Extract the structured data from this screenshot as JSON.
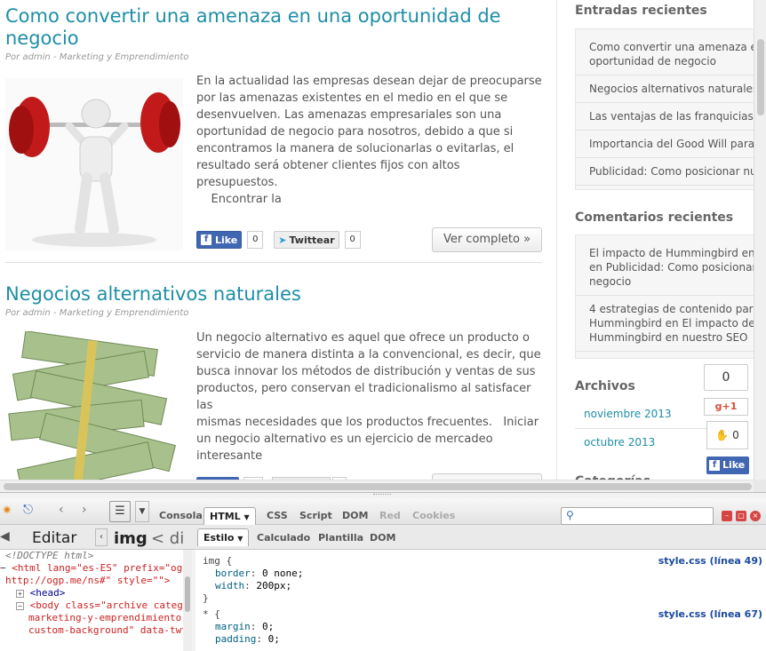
{
  "posts": [
    {
      "title_line1": "Como convertir una amenaza en una oportunidad de",
      "title_line2": "negocio",
      "meta": "Por admin - Marketing y Emprendimiento",
      "excerpt": [
        "En la actualidad las empresas desean dejar de preocuparse",
        "por las amenazas existentes en el medio en el que se",
        "desenvuelven. Las amenazas empresariales son una",
        "oportunidad de negocio para nosotros, debido a que si",
        "encontramos la manera de solucionarlas o evitarlas, el",
        "resultado será obtener clientes fijos con altos presupuestos.",
        "    Encontrar la"
      ],
      "like_label": "Like",
      "like_count": "0",
      "tweet_label": "Twittear",
      "tweet_count": "0",
      "more_label": "Ver completo »"
    },
    {
      "title_line1": "Negocios alternativos naturales",
      "meta": "Por admin - Marketing y Emprendimiento",
      "excerpt": [
        "Un negocio alternativo es aquel que ofrece un producto o",
        "servicio de manera distinta a la convencional, es decir, que",
        "busca innovar los métodos de distribución y ventas de sus",
        "productos, pero conservan el tradicionalismo al satisfacer las",
        "mismas necesidades que los productos frecuentes.   Iniciar",
        "un negocio alternativo es un ejercicio de mercadeo",
        "interesante"
      ]
    }
  ],
  "sidebar": {
    "recent_title": "Entradas recientes",
    "recent": [
      "Como convertir una amenaza e",
      "oportunidad de negocio",
      "Negocios alternativos naturales",
      "Las ventajas de las franquicias c",
      "Importancia del Good Will para",
      "Publicidad: Como posicionar nu"
    ],
    "comments_title": "Comentarios recientes",
    "comments": [
      "El impacto de Hummingbird en",
      "en Publicidad: Como posicionar",
      "negocio",
      "4 estrategias de contenido para",
      "Hummingbird en El impacto de",
      "Hummingbird en nuestro SEO"
    ],
    "archives_title": "Archivos",
    "archives": [
      "noviembre 2013",
      "octubre 2013"
    ],
    "cat_title": "Categorías"
  },
  "float_share": {
    "count": "0",
    "gplus": "+1",
    "thumb_count": "0",
    "like": "Like"
  },
  "firebug": {
    "tabs": [
      "Consola",
      "HTML",
      "CSS",
      "Script",
      "DOM",
      "Red",
      "Cookies"
    ],
    "edit_label": "Editar",
    "crumb": "img",
    "crumb_next": "< di",
    "subtabs": [
      "Estilo",
      "Calculado",
      "Plantilla",
      "DOM"
    ],
    "html_lines": [
      {
        "t": "<!DOCTYPE html>"
      },
      {
        "t": "<html lang=\"es-ES\" prefix=\"og:"
      },
      {
        "t": "http://ogp.me/ns#\" style=\"\">"
      },
      {
        "t": "<head>"
      },
      {
        "t": "<body class=\"archive categor"
      },
      {
        "t": "marketing-y-emprendimiento"
      },
      {
        "t": "custom-background\" data-twtt"
      }
    ],
    "css_rules": [
      {
        "selector": "img {",
        "props": [
          [
            "border",
            "0 none;"
          ],
          [
            "width",
            "200px;"
          ]
        ],
        "source": "style.css (línea 49)"
      },
      {
        "selector": "* {",
        "props": [
          [
            "margin",
            "0;"
          ],
          [
            "padding",
            "0;"
          ]
        ],
        "source": "style.css (línea 67)"
      }
    ]
  },
  "colors": {
    "link": "#1e8ea6",
    "fb": "#4267b2"
  }
}
